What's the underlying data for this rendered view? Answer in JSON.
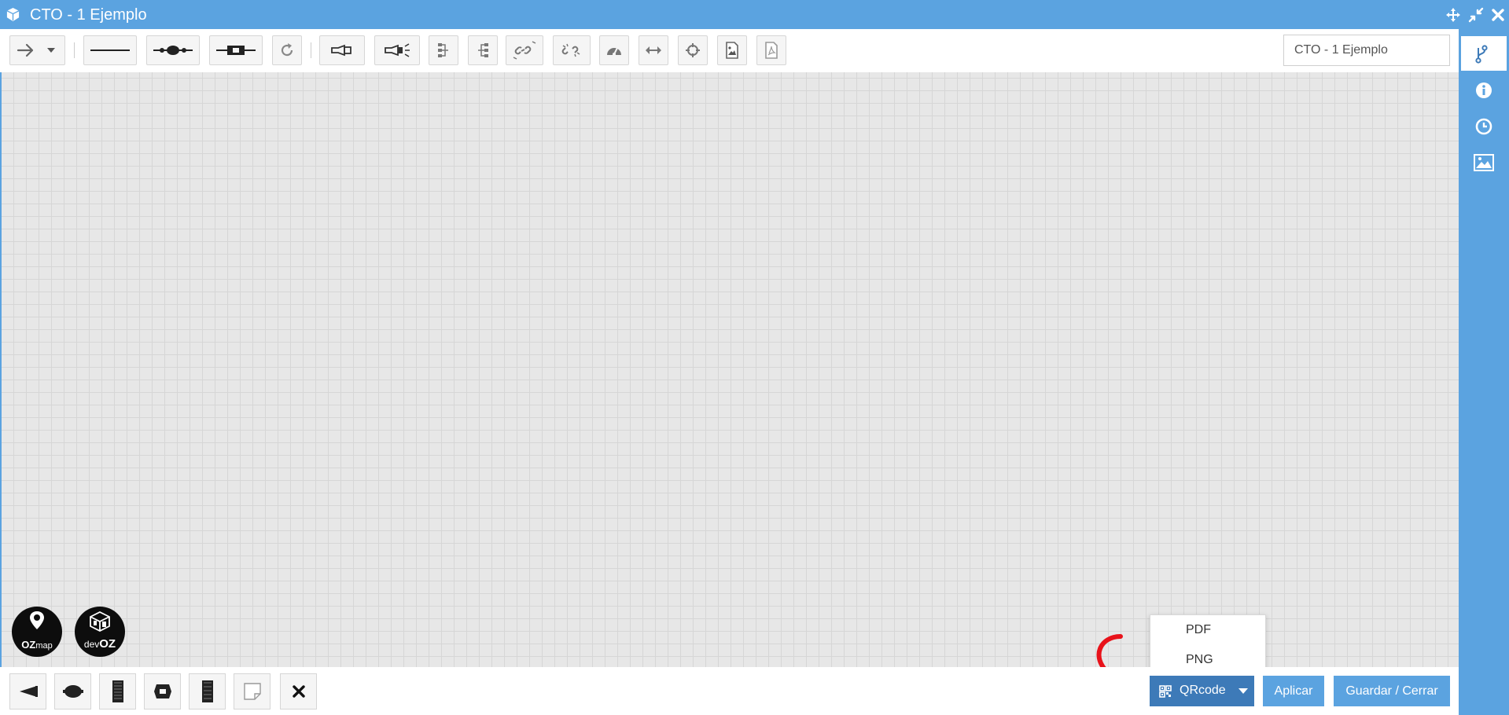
{
  "window": {
    "title": "CTO - 1 Ejemplo",
    "icon": "cube-icon",
    "controls": [
      "move-icon",
      "compress-icon",
      "close-icon"
    ]
  },
  "toolbar": {
    "buttons": [
      {
        "name": "arrow-tool-button",
        "icon": "arrow-right-icon"
      },
      {
        "name": "line-tool-button",
        "icon": "line-icon"
      },
      {
        "name": "splice-tool-button",
        "icon": "splice-line-icon"
      },
      {
        "name": "connector-tool-button",
        "icon": "connector-line-icon"
      },
      {
        "name": "redo-button",
        "icon": "redo-icon"
      },
      {
        "name": "flashlight-button",
        "icon": "flashlight-icon"
      },
      {
        "name": "flashlight-on-button",
        "icon": "flashlight-on-icon"
      },
      {
        "name": "align-left-button",
        "icon": "align-tree-icon"
      },
      {
        "name": "align-right-button",
        "icon": "align-tree-reverse-icon"
      },
      {
        "name": "link-button",
        "icon": "link-icon"
      },
      {
        "name": "unlink-button",
        "icon": "unlink-icon"
      },
      {
        "name": "gauge-button",
        "icon": "dashboard-icon"
      },
      {
        "name": "distance-button",
        "icon": "arrows-h-icon"
      },
      {
        "name": "center-button",
        "icon": "crosshairs-icon"
      },
      {
        "name": "export-image-button",
        "icon": "file-image-icon"
      },
      {
        "name": "export-pdf-button",
        "icon": "file-pdf-icon"
      }
    ],
    "name_field": {
      "value": "CTO - 1 Ejemplo"
    }
  },
  "sidebar": {
    "tabs": [
      {
        "name": "tab-diagram",
        "icon": "fork-icon",
        "active": true
      },
      {
        "name": "tab-info",
        "icon": "info-icon",
        "active": false
      },
      {
        "name": "tab-history",
        "icon": "clock-icon",
        "active": false
      },
      {
        "name": "tab-images",
        "icon": "image-icon",
        "active": false
      }
    ]
  },
  "logos": {
    "ozmap": {
      "text_bold": "OZ",
      "text_light": "map"
    },
    "devoz": {
      "text_light": "dev",
      "text_bold": "OZ"
    }
  },
  "bottom_toolbar": {
    "buttons": [
      {
        "name": "splitter-button",
        "icon": "splitter-icon"
      },
      {
        "name": "closure-button",
        "icon": "closure-icon"
      },
      {
        "name": "dio-button",
        "icon": "dio-icon"
      },
      {
        "name": "connector-button",
        "icon": "connector-box-icon"
      },
      {
        "name": "switch-button",
        "icon": "switch-icon"
      },
      {
        "name": "note-button",
        "icon": "sticky-note-icon"
      },
      {
        "name": "delete-button",
        "icon": "times-icon"
      }
    ]
  },
  "actions": {
    "qrcode_label": "QRcode",
    "apply_label": "Aplicar",
    "save_close_label": "Guardar / Cerrar"
  },
  "qrcode_menu": {
    "items": [
      "PDF",
      "PNG"
    ]
  },
  "colors": {
    "accent": "#5ba3e0",
    "qrcode_button": "#3d7ab8",
    "canvas": "#e7e7e7",
    "annotation_arrow": "#e8121a"
  }
}
